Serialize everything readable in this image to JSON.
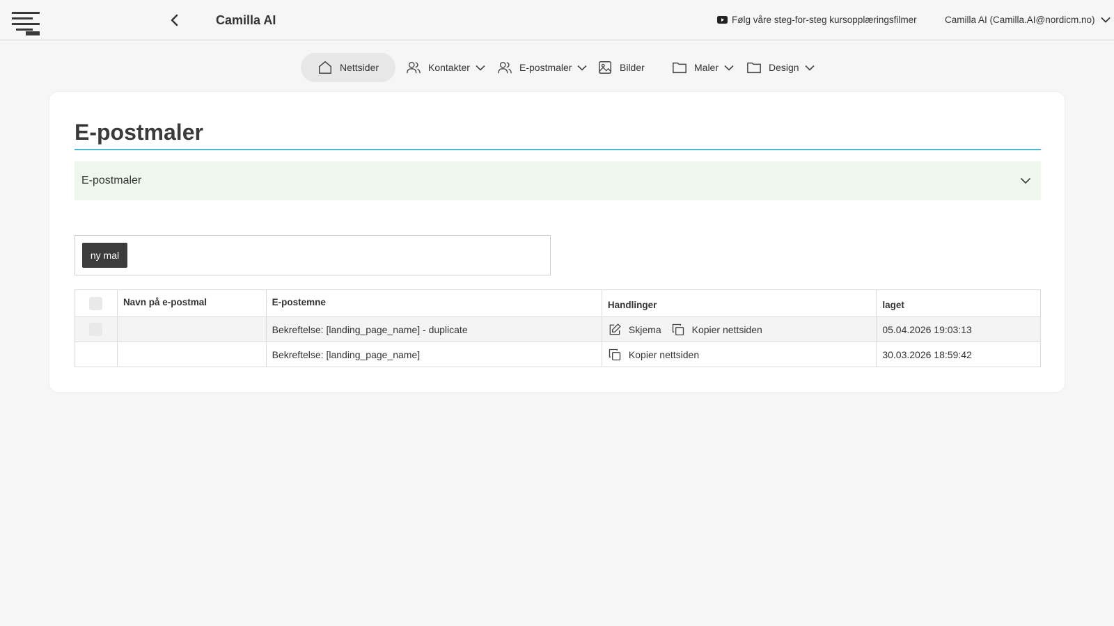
{
  "header": {
    "app_title": "Camilla AI",
    "tutorial_link": "Følg våre steg-for-steg kursopplæringsfilmer",
    "user": "Camilla AI (Camilla.AI@nordicm.no)"
  },
  "nav": {
    "items": [
      {
        "label": "Nettsider",
        "icon": "home-icon",
        "active": true
      },
      {
        "label": "Kontakter",
        "icon": "users-icon",
        "dropdown": true
      },
      {
        "label": "E-postmaler",
        "icon": "users-icon",
        "dropdown": true
      },
      {
        "label": "Bilder",
        "icon": "image-icon"
      },
      {
        "label": "Maler",
        "icon": "folder-icon",
        "dropdown": true
      },
      {
        "label": "Design",
        "icon": "folder-icon",
        "dropdown": true
      }
    ]
  },
  "page": {
    "title": "E-postmaler",
    "accordion_label": "E-postmaler",
    "new_button": "ny mal"
  },
  "table": {
    "headers": [
      "",
      "Navn på e-postmal",
      "E-postemne",
      "Handlinger",
      "laget"
    ],
    "rows": [
      {
        "name": "",
        "subject": "Bekreftelse: [landing_page_name] - duplicate",
        "actions": [
          "Skjema",
          "Kopier nettsiden"
        ],
        "created": "05.04.2026 19:03:13",
        "has_checkbox": true
      },
      {
        "name": "",
        "subject": "Bekreftelse: [landing_page_name]",
        "actions": [
          "Kopier nettsiden"
        ],
        "created": "30.03.2026 18:59:42",
        "has_checkbox": false
      }
    ]
  },
  "colors": {
    "accent_rule": "#4bb8d3",
    "accordion_bg": "#eef7ec",
    "button_bg": "#3c3c3c"
  }
}
